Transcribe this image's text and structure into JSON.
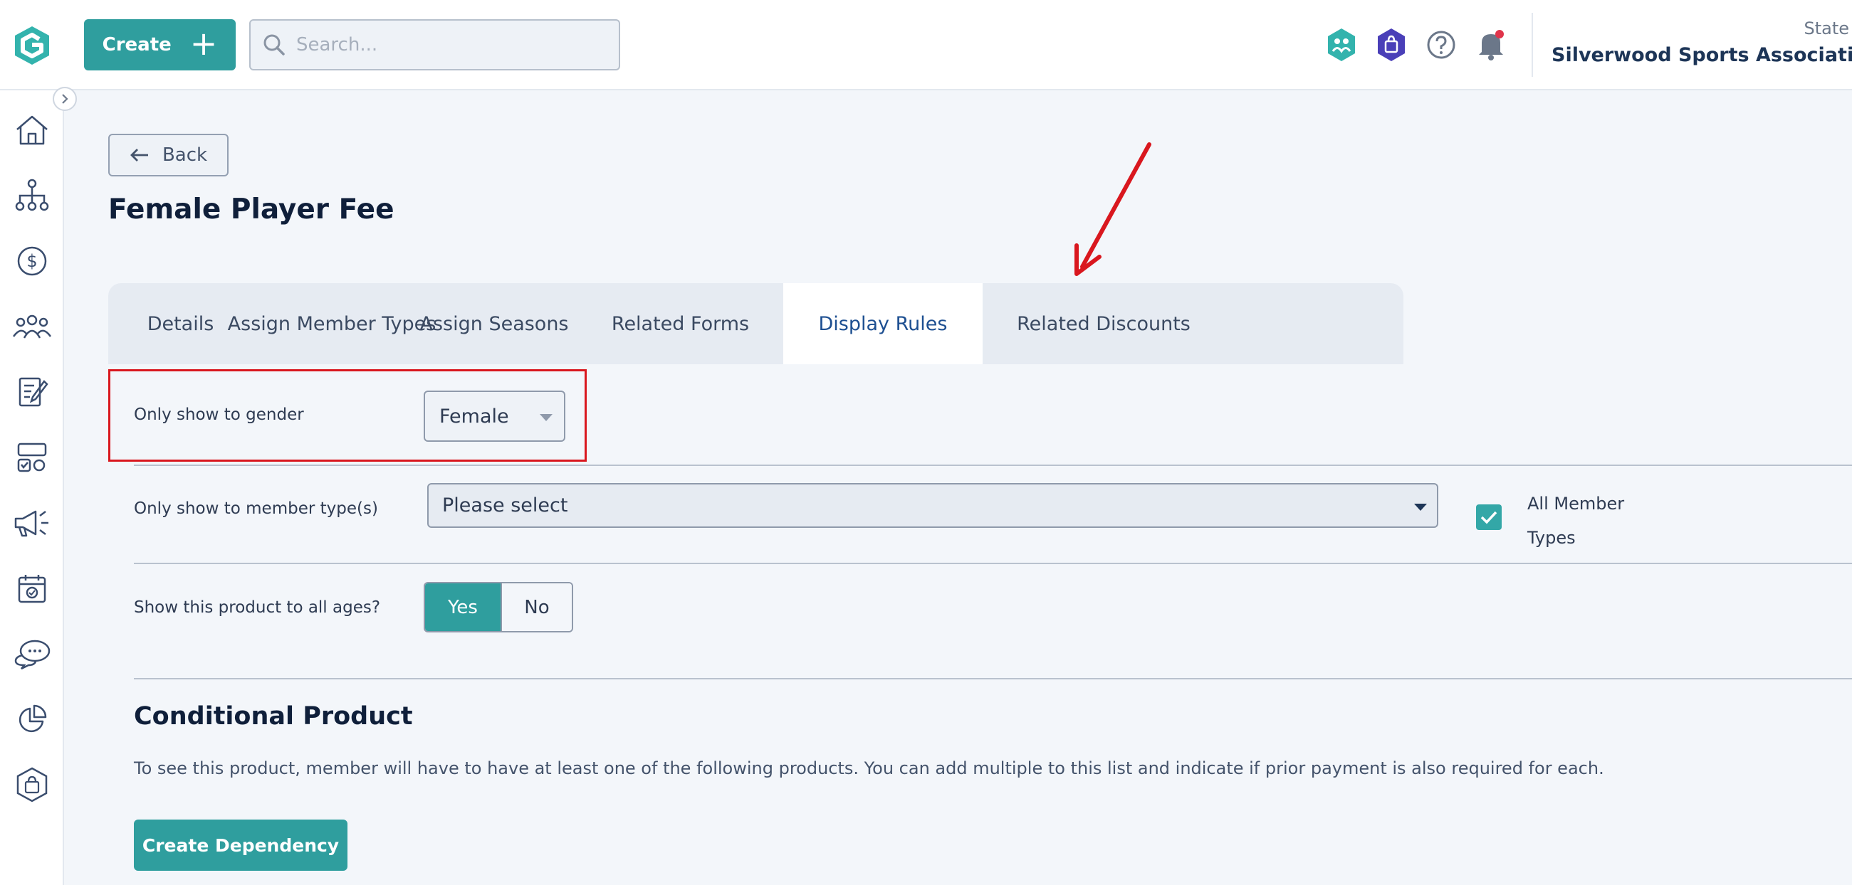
{
  "header": {
    "create_label": "Create",
    "search_placeholder": "Search...",
    "org_type": "State",
    "org_name": "Silverwood Sports Association",
    "icons": [
      "members-icon",
      "shop-icon",
      "help-icon",
      "notification-bell-icon"
    ]
  },
  "sidebar": {
    "icons": [
      "home-icon",
      "organisation-icon",
      "finance-icon",
      "people-icon",
      "forms-icon",
      "products-icon",
      "marketing-icon",
      "events-icon",
      "communications-icon",
      "reports-icon",
      "shop-icon"
    ]
  },
  "page": {
    "back_label": "Back",
    "title": "Female Player Fee"
  },
  "tabs": [
    {
      "label": "Details",
      "active": false
    },
    {
      "label": "Assign Member Types",
      "active": false
    },
    {
      "label": "Assign Seasons",
      "active": false
    },
    {
      "label": "Related Forms",
      "active": false
    },
    {
      "label": "Display Rules",
      "active": true
    },
    {
      "label": "Related Discounts",
      "active": false
    }
  ],
  "display_rules": {
    "gender_label": "Only show to gender",
    "gender_value": "Female",
    "member_type_label": "Only show to member type(s)",
    "member_type_placeholder": "Please select",
    "all_member_types_label": "All Member Types",
    "all_member_types_checked": true,
    "ages_label": "Show this product to all ages?",
    "ages_yes": "Yes",
    "ages_no": "No",
    "ages_selected": "Yes"
  },
  "conditional": {
    "title": "Conditional Product",
    "description": "To see this product, member will have to have at least one of the following products. You can add multiple to this list and indicate if prior payment is also required for each.",
    "button_label": "Create Dependency"
  },
  "colors": {
    "accent": "#2f9e9e",
    "annotation": "#d9171e",
    "active_tab_text": "#1d4f91"
  }
}
